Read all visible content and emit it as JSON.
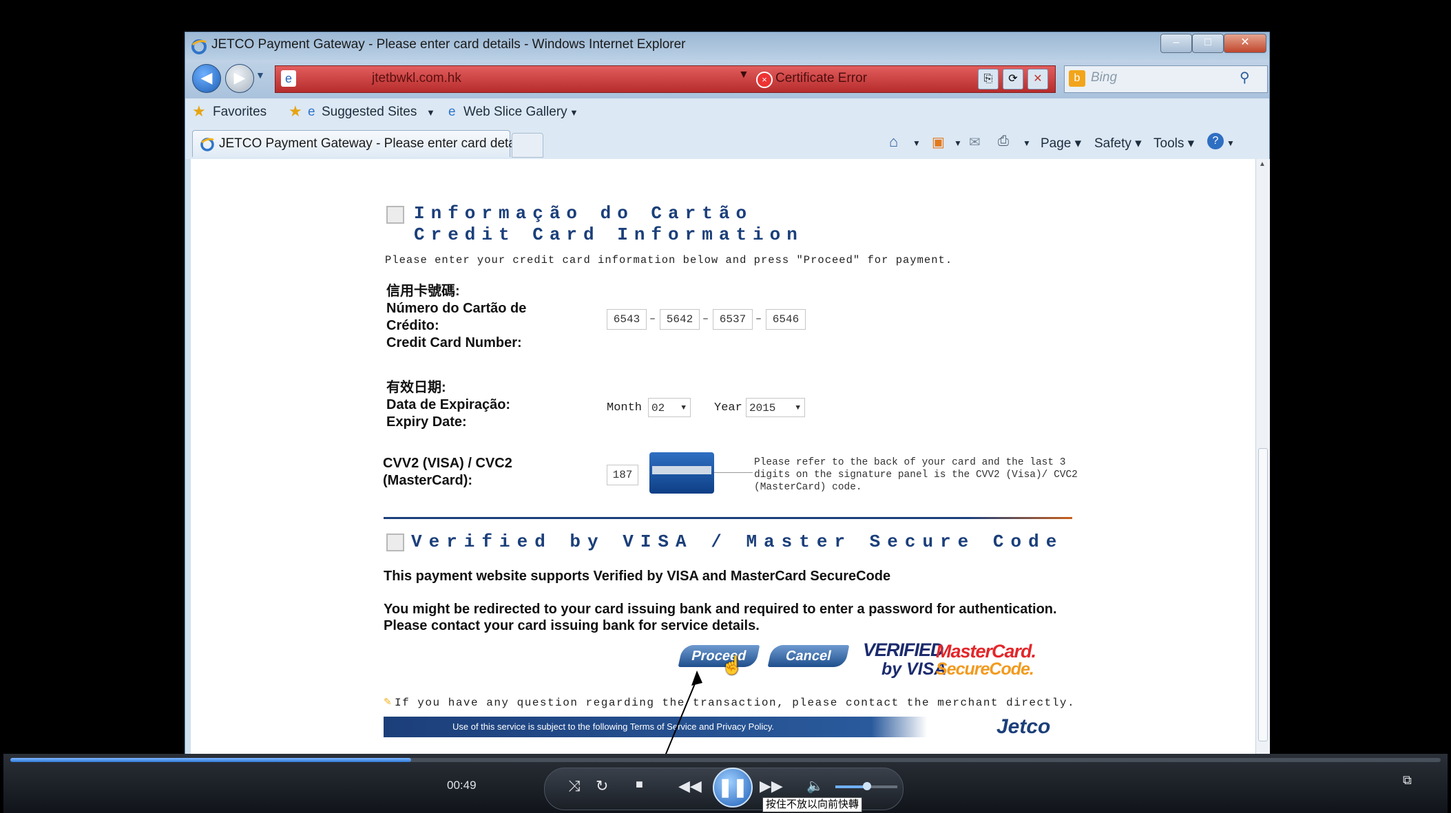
{
  "window": {
    "title": "JETCO Payment Gateway - Please enter card details - Windows Internet Explorer"
  },
  "address": {
    "url": "jtetbwkl.com.hk",
    "certificate": "Certificate Error",
    "search_placeholder": "Bing"
  },
  "favorites": {
    "label": "Favorites",
    "suggested": "Suggested Sites",
    "webslice": "Web Slice Gallery"
  },
  "tab": {
    "title": "JETCO Payment Gateway - Please enter card details"
  },
  "commands": {
    "page": "Page",
    "safety": "Safety",
    "tools": "Tools"
  },
  "card_section": {
    "heading_pt": "Informação do Cartão",
    "heading_en": "Credit Card Information",
    "instructions": "Please enter your credit card information below and press \"Proceed\" for payment.",
    "number_label_zh": "信用卡號碼:",
    "number_label_pt": "Número do Cartão de Crédito:",
    "number_label_en": "Credit Card Number:",
    "number_parts": [
      "6543",
      "5642",
      "6537",
      "6546"
    ],
    "expiry_label_zh": "有效日期:",
    "expiry_label_pt": "Data de Expiração:",
    "expiry_label_en": "Expiry Date:",
    "month_label": "Month",
    "month_value": "02",
    "year_label": "Year",
    "year_value": "2015",
    "cvv_label": "CVV2 (VISA) / CVC2 (MasterCard):",
    "cvv_value": "187",
    "cvv_help": "Please refer to the back of your card and the last 3 digits on the signature panel is the CVV2 (Visa)/ CVC2 (MasterCard) code."
  },
  "verify_section": {
    "heading": "Verified by VISA / Master Secure Code",
    "line1": "This payment website supports Verified by VISA and MasterCard SecureCode",
    "line2": "You might be redirected to your card issuing bank and required to enter a password for authentication. Please contact your card issuing bank for service details.",
    "proceed": "Proceed",
    "cancel": "Cancel",
    "visa_logo_1": "VERIFIED",
    "visa_logo_2": "by VISA",
    "mc_logo_1": "MasterCard.",
    "mc_logo_2": "SecureCode.",
    "footer_note": "If you have any question regarding the transaction, please contact the merchant directly.",
    "footer_bar": "Use of this service is subject to the following Terms of Service and Privacy Policy.",
    "jetco": "Jetco"
  },
  "player": {
    "time": "00:49",
    "tooltip": "按住不放以向前快轉",
    "progress": 0.28
  },
  "colors": {
    "accent": "#1b3f7a",
    "mastercard": "#e3262a"
  }
}
